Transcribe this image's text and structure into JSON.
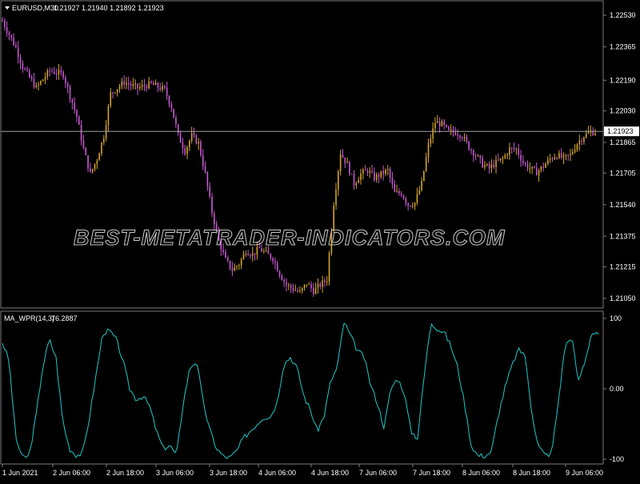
{
  "main_header": {
    "symbol": "EURUSD,M30",
    "ohlc": "1.21927 1.21940 1.21892 1.21923"
  },
  "indicator_header": {
    "name": "MA_WPR(14,3)",
    "value": "76.2887"
  },
  "watermark": "BEST-METATRADER-INDICATORS.COM",
  "current_price_label": "1.21923",
  "colors": {
    "background": "#000000",
    "bull": "#d4a52a",
    "bear": "#c75bd1",
    "wpr_line": "#1ec8c8",
    "grid": "#7a7a7a",
    "price_line": "#a0a0a0"
  },
  "chart_data": [
    {
      "type": "candlestick",
      "title": "EURUSD,M30",
      "ylim": [
        1.2093,
        1.2263
      ],
      "y_ticks": [
        "1.22530",
        "1.22365",
        "1.22190",
        "1.22030",
        "1.21865",
        "1.21705",
        "1.21540",
        "1.21375",
        "1.21215",
        "1.21050"
      ],
      "current_price": 1.21923,
      "close_path": [
        [
          0,
          1.225
        ],
        [
          2,
          1.2236
        ],
        [
          3,
          1.2226
        ],
        [
          5,
          1.2215
        ],
        [
          7,
          1.2224
        ],
        [
          9,
          1.2222
        ],
        [
          11,
          1.22
        ],
        [
          12,
          1.2183
        ],
        [
          13,
          1.217
        ],
        [
          14,
          1.2178
        ],
        [
          15,
          1.219
        ],
        [
          16,
          1.2212
        ],
        [
          18,
          1.2218
        ],
        [
          20,
          1.2215
        ],
        [
          22,
          1.2217
        ],
        [
          24,
          1.2214
        ],
        [
          25,
          1.2205
        ],
        [
          26,
          1.219
        ],
        [
          27,
          1.2182
        ],
        [
          28,
          1.219
        ],
        [
          29,
          1.2186
        ],
        [
          30,
          1.217
        ],
        [
          31,
          1.215
        ],
        [
          32,
          1.2135
        ],
        [
          33,
          1.2125
        ],
        [
          34,
          1.212
        ],
        [
          35,
          1.2123
        ],
        [
          36,
          1.213
        ],
        [
          37,
          1.2128
        ],
        [
          38,
          1.2131
        ],
        [
          40,
          1.2126
        ],
        [
          41,
          1.2118
        ],
        [
          42,
          1.2112
        ],
        [
          43,
          1.211
        ],
        [
          44,
          1.2108
        ],
        [
          45,
          1.2113
        ],
        [
          46,
          1.2109
        ],
        [
          47,
          1.2112
        ],
        [
          48,
          1.2115
        ],
        [
          49,
          1.2155
        ],
        [
          50,
          1.2181
        ],
        [
          51,
          1.2175
        ],
        [
          52,
          1.2165
        ],
        [
          53,
          1.217
        ],
        [
          54,
          1.2172
        ],
        [
          55,
          1.2168
        ],
        [
          56,
          1.217
        ],
        [
          57,
          1.2172
        ],
        [
          58,
          1.216
        ],
        [
          59,
          1.216
        ],
        [
          60,
          1.2154
        ],
        [
          61,
          1.2155
        ],
        [
          62,
          1.2165
        ],
        [
          63,
          1.2185
        ],
        [
          64,
          1.2197
        ],
        [
          65,
          1.2196
        ],
        [
          66,
          1.2192
        ],
        [
          67,
          1.2192
        ],
        [
          68,
          1.219
        ],
        [
          69,
          1.2184
        ],
        [
          70,
          1.218
        ],
        [
          71,
          1.2175
        ],
        [
          72,
          1.2173
        ],
        [
          73,
          1.2176
        ],
        [
          74,
          1.2178
        ],
        [
          75,
          1.2183
        ],
        [
          76,
          1.2183
        ],
        [
          77,
          1.2176
        ],
        [
          78,
          1.2173
        ],
        [
          79,
          1.2171
        ],
        [
          80,
          1.2174
        ],
        [
          81,
          1.2178
        ],
        [
          82,
          1.218
        ],
        [
          83,
          1.2178
        ],
        [
          84,
          1.218
        ],
        [
          85,
          1.2186
        ],
        [
          86,
          1.219
        ],
        [
          87,
          1.2192
        ]
      ],
      "bar_count": 88
    },
    {
      "type": "line",
      "title": "MA_WPR(14,3)",
      "series": [
        {
          "name": "MA_WPR(14,3)",
          "values": []
        }
      ],
      "ylim": [
        -100,
        100
      ],
      "y_ticks": [
        "100",
        "0.00",
        "-100"
      ],
      "wpr_path": [
        [
          0,
          66
        ],
        [
          1,
          40
        ],
        [
          2,
          -70
        ],
        [
          3,
          -98
        ],
        [
          4,
          -95
        ],
        [
          5,
          -40
        ],
        [
          6,
          30
        ],
        [
          7,
          70
        ],
        [
          8,
          45
        ],
        [
          9,
          -45
        ],
        [
          10,
          -85
        ],
        [
          11,
          -94
        ],
        [
          12,
          -92
        ],
        [
          13,
          -40
        ],
        [
          14,
          20
        ],
        [
          15,
          80
        ],
        [
          16,
          82
        ],
        [
          17,
          70
        ],
        [
          18,
          40
        ],
        [
          19,
          0
        ],
        [
          20,
          -15
        ],
        [
          21,
          -10
        ],
        [
          22,
          -25
        ],
        [
          23,
          -60
        ],
        [
          24,
          -85
        ],
        [
          25,
          -80
        ],
        [
          26,
          -95
        ],
        [
          27,
          -20
        ],
        [
          28,
          30
        ],
        [
          29,
          40
        ],
        [
          30,
          -20
        ],
        [
          31,
          -60
        ],
        [
          32,
          -85
        ],
        [
          33,
          -96
        ],
        [
          34,
          -98
        ],
        [
          35,
          -88
        ],
        [
          36,
          -70
        ],
        [
          37,
          -60
        ],
        [
          38,
          -50
        ],
        [
          39,
          -40
        ],
        [
          40,
          -40
        ],
        [
          41,
          -20
        ],
        [
          42,
          35
        ],
        [
          43,
          45
        ],
        [
          44,
          30
        ],
        [
          45,
          -10
        ],
        [
          46,
          -30
        ],
        [
          47,
          -60
        ],
        [
          48,
          -40
        ],
        [
          49,
          10
        ],
        [
          50,
          30
        ],
        [
          51,
          95
        ],
        [
          52,
          75
        ],
        [
          53,
          55
        ],
        [
          54,
          45
        ],
        [
          55,
          5
        ],
        [
          56,
          -20
        ],
        [
          57,
          -55
        ],
        [
          58,
          0
        ],
        [
          59,
          15
        ],
        [
          60,
          -5
        ],
        [
          61,
          -60
        ],
        [
          62,
          -70
        ],
        [
          63,
          20
        ],
        [
          64,
          95
        ],
        [
          65,
          85
        ],
        [
          66,
          80
        ],
        [
          67,
          60
        ],
        [
          68,
          30
        ],
        [
          69,
          -20
        ],
        [
          70,
          -80
        ],
        [
          71,
          -95
        ],
        [
          72,
          -95
        ],
        [
          73,
          -90
        ],
        [
          74,
          -40
        ],
        [
          75,
          0
        ],
        [
          76,
          30
        ],
        [
          77,
          55
        ],
        [
          78,
          50
        ],
        [
          79,
          -30
        ],
        [
          80,
          -80
        ],
        [
          81,
          -94
        ],
        [
          82,
          -92
        ],
        [
          83,
          -20
        ],
        [
          84,
          60
        ],
        [
          85,
          75
        ],
        [
          86,
          10
        ],
        [
          87,
          40
        ],
        [
          88,
          80
        ],
        [
          89,
          76
        ]
      ]
    }
  ],
  "x_axis_labels": [
    "1 Jun 2021",
    "2 Jun 06:00",
    "2 Jun 18:00",
    "3 Jun 06:00",
    "3 Jun 18:00",
    "4 Jun 06:00",
    "4 Jun 18:00",
    "7 Jun 06:00",
    "7 Jun 18:00",
    "8 Jun 06:00",
    "8 Jun 18:00",
    "9 Jun 06:00"
  ]
}
